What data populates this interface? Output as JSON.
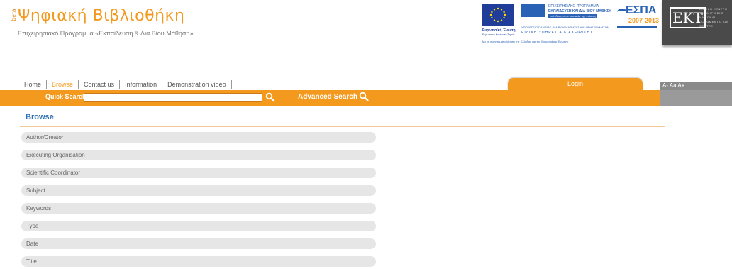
{
  "header": {
    "beta": "beta",
    "title": "Ψηφιακή Βιβλιοθήκη",
    "subtitle": "Επιχειρησιακό Πρόγραμμα «Εκπαίδευση & Διά Βίου Μάθηση»"
  },
  "sponsors": {
    "eu_caption": "Ευρωπαϊκή Ένωση",
    "eu_caption_small": "Ευρωπαϊκό Κοινωνικό Ταμείο",
    "program_line1": "ΕΠΙΧΕΙΡΗΣΙΑΚΟ ΠΡΟΓΡΑΜΜΑ",
    "program_line2": "ΕΚΠΑΙΔΕΥΣΗ ΚΑΙ ΔΙΑ ΒΙΟΥ ΜΑΘΗΣΗ",
    "program_line3": "επένδυση στην κοινωνία της γνώσης",
    "program_sub1": "ΥΠΟΥΡΓΕΙΟ ΠΑΙΔΕΙΑΣ, ΔΙΑ ΒΙΟΥ ΜΑΘΗΣΗΣ ΚΑΙ ΘΡΗΣΚΕΥΜΑΤΩΝ",
    "program_sub2": "ΕΙΔΙΚΗ ΥΠΗΡΕΣΙΑ ΔΙΑΧΕΙΡΙΣΗΣ",
    "espa": "ΕΣΠΑ",
    "espa_years": "2007-2013",
    "tagline": "Με τη συγχρηματοδότηση της Ελλάδας και της Ευρωπαϊκής Ένωσης",
    "ekt_mark": "EKT",
    "ekt_text": [
      "ΕΘΝΙΚΟ ΚΕΝΤΡΟ",
      "ΤΕΚΜΗΡΙΩΣΗΣ",
      "NATIONAL",
      "DOCUMENTATION",
      "CENTRE"
    ]
  },
  "nav": {
    "items": [
      {
        "label": "Home",
        "active": false
      },
      {
        "label": "Browse",
        "active": true
      },
      {
        "label": "Contact us",
        "active": false
      },
      {
        "label": "Information",
        "active": false
      },
      {
        "label": "Demonstration video",
        "active": false
      }
    ],
    "login": "Login",
    "font_size_controls": "A-  Aa  A+"
  },
  "search": {
    "quick_label": "Quick Search",
    "quick_value": "",
    "advanced_label": "Advanced Search"
  },
  "browse": {
    "title": "Browse",
    "items": [
      "Author/Creator",
      "Executing Organisation",
      "Scientific Coordinator",
      "Subject",
      "Keywords",
      "Type",
      "Date",
      "Title"
    ]
  },
  "colors": {
    "accent": "#f39a1e",
    "link_blue": "#2a6fb3",
    "item_bg": "#e6e6e6"
  }
}
